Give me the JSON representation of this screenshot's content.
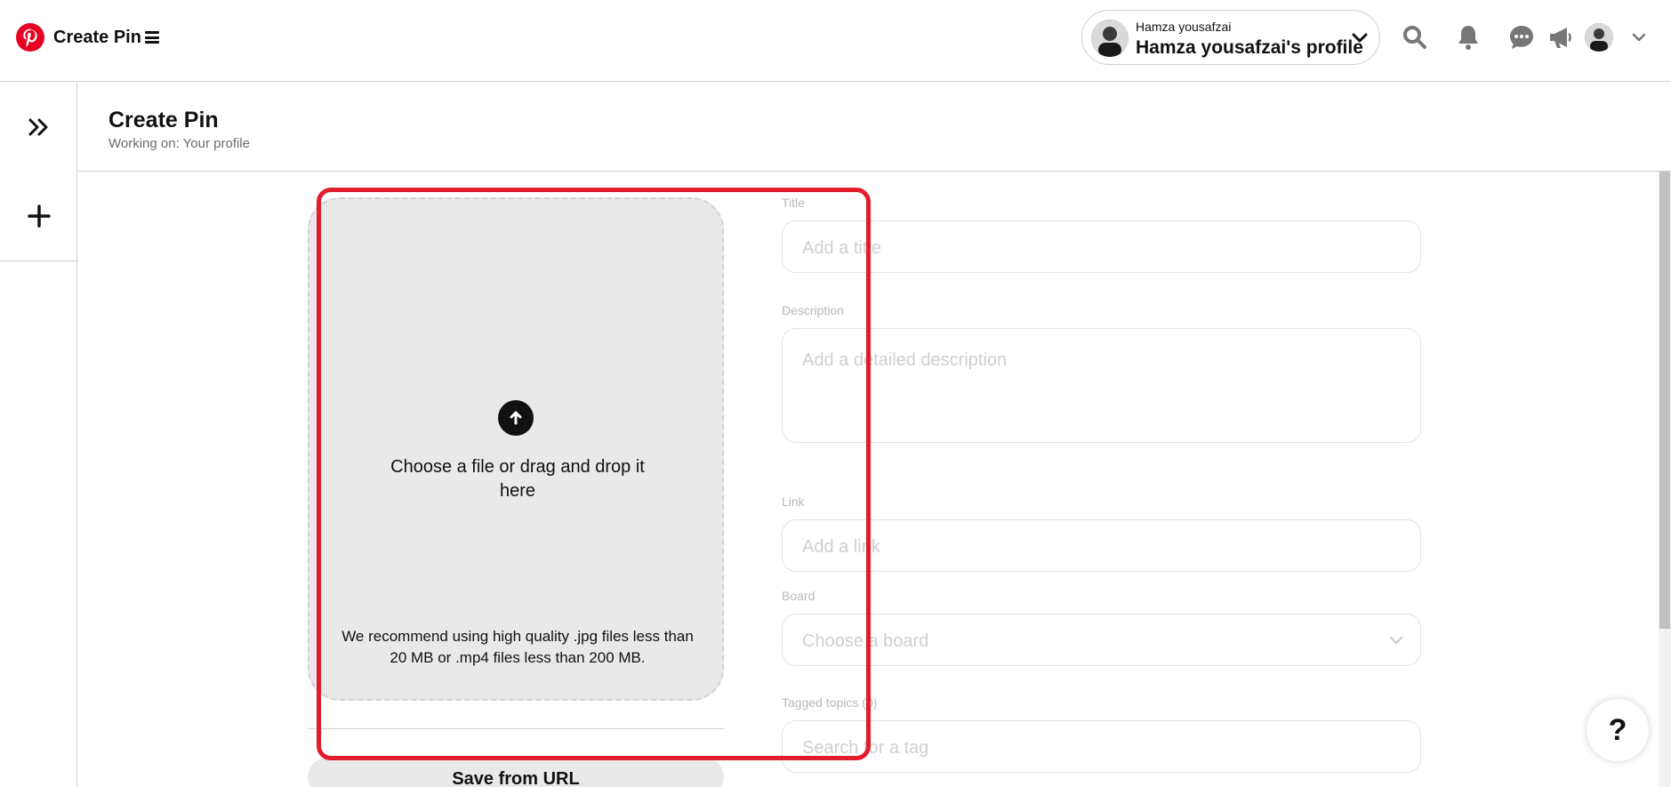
{
  "header": {
    "title": "Create Pin",
    "profile_small": "Hamza yousafzai",
    "profile_big": "Hamza yousafzai's profile",
    "icons": [
      "pinterest-logo-icon",
      "hamburger-menu-icon",
      "search-icon",
      "bell-icon",
      "chat-icon",
      "megaphone-icon",
      "chevron-down-icon"
    ]
  },
  "rail": {
    "icons": [
      "double-chevron-right-icon",
      "plus-icon"
    ]
  },
  "page": {
    "title": "Create Pin",
    "subtitle": "Working on: Your profile"
  },
  "upload": {
    "main_text": "Choose a file or drag and drop it here",
    "note": "We recommend using high quality .jpg files less than 20 MB or .mp4 files less than 200 MB.",
    "save_from_url": "Save from URL"
  },
  "form": {
    "title_label": "Title",
    "title_placeholder": "Add a title",
    "description_label": "Description",
    "description_placeholder": "Add a detailed description",
    "link_label": "Link",
    "link_placeholder": "Add a link",
    "board_label": "Board",
    "board_placeholder": "Choose a board",
    "topics_label": "Tagged topics (0)",
    "topics_placeholder": "Search for a tag"
  },
  "help": {
    "label": "?"
  },
  "colors": {
    "brand": "#e60023",
    "highlight": "#e11d2c",
    "upload_bg": "#e9e9e9"
  }
}
